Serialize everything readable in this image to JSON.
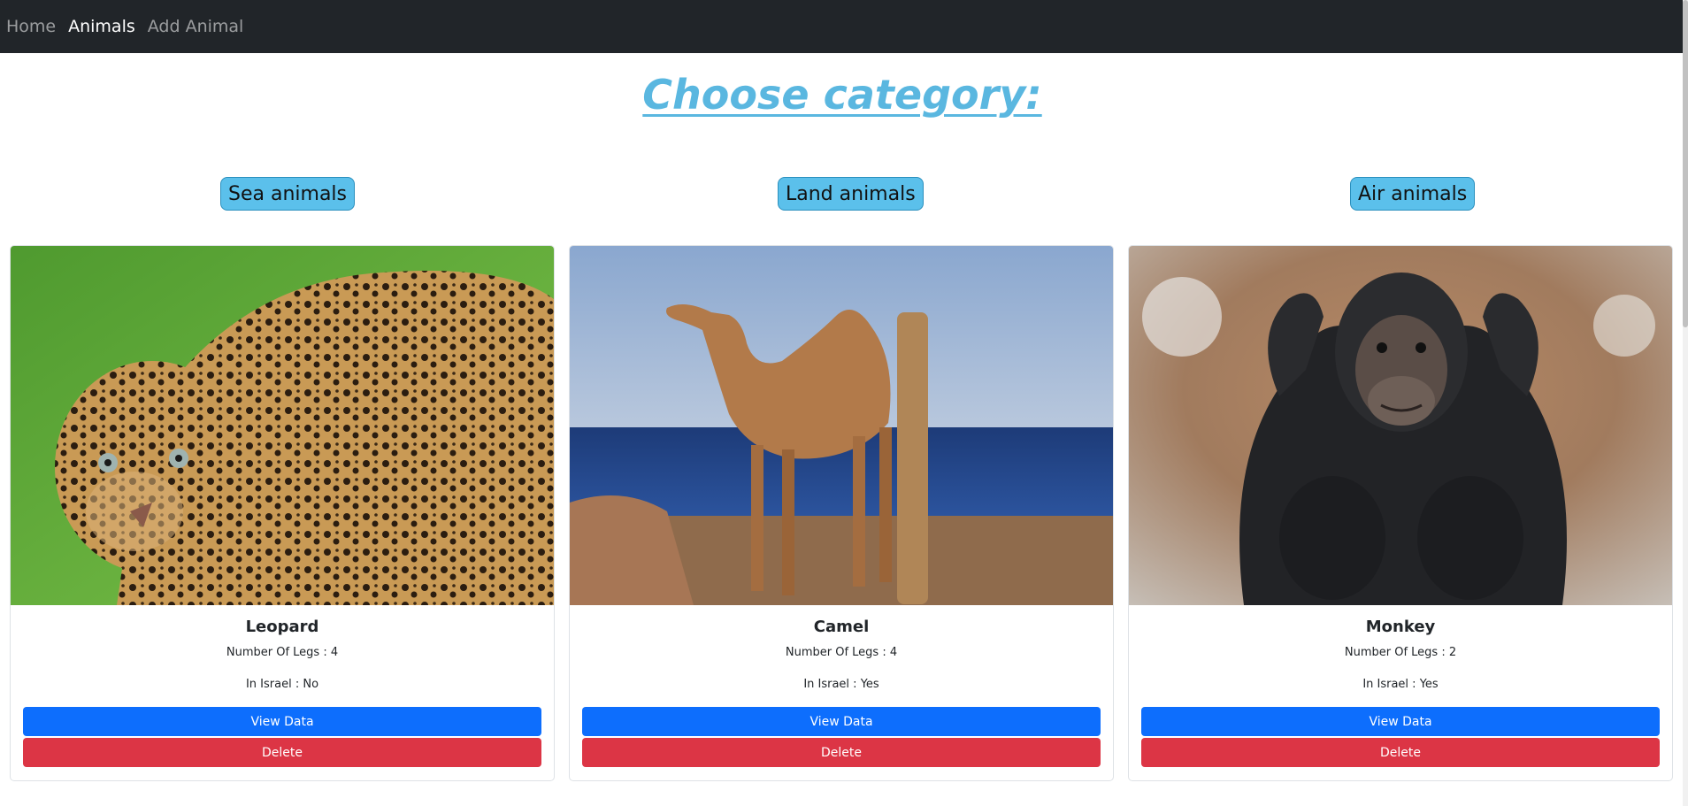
{
  "navbar": {
    "links": [
      {
        "label": "Home",
        "active": false
      },
      {
        "label": "Animals",
        "active": true
      },
      {
        "label": "Add Animal",
        "active": false
      }
    ]
  },
  "heading": "Choose category:",
  "categories": [
    {
      "label": "Sea animals"
    },
    {
      "label": "Land animals"
    },
    {
      "label": "Air animals"
    }
  ],
  "cards": [
    {
      "name": "Leopard",
      "legs": "Number Of Legs : 4",
      "israel": "In Israel : No",
      "view_label": "View Data",
      "delete_label": "Delete",
      "image": "leopard-photo"
    },
    {
      "name": "Camel",
      "legs": "Number Of Legs : 4",
      "israel": "In Israel : Yes",
      "view_label": "View Data",
      "delete_label": "Delete",
      "image": "camel-photo"
    },
    {
      "name": "Monkey",
      "legs": "Number Of Legs : 2",
      "israel": "In Israel : Yes",
      "view_label": "View Data",
      "delete_label": "Delete",
      "image": "chimpanzee-photo"
    }
  ],
  "colors": {
    "navbar_bg": "#212529",
    "heading": "#5ab7e0",
    "category_bg": "#5bc0eb",
    "primary": "#0d6efd",
    "danger": "#dc3545"
  }
}
